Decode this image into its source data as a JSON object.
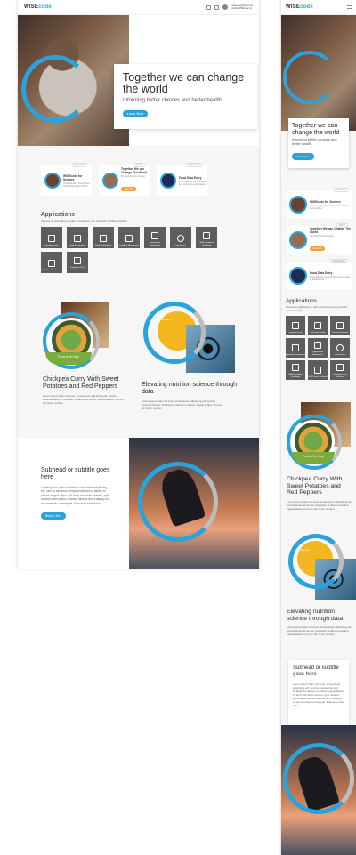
{
  "brand": {
    "logo_main": "WISE",
    "logo_accent": "code"
  },
  "header": {
    "user_name": "wisecode@wise.co.uk",
    "user_org": "Global WISEcode Inc."
  },
  "hero": {
    "title": "Together we can change the world",
    "subtitle": "Informing better choices and better health",
    "button": "Learn More"
  },
  "features": [
    {
      "tag": "Research",
      "title": "WISEcode for Science",
      "desc": "Understanding the science behind food and nutrition"
    },
    {
      "tag": "Article",
      "title": "Together We can Change The World",
      "desc": "By Food Science Insider",
      "button": "Read This"
    },
    {
      "tag": "Applications",
      "title": "Food Data Entry",
      "desc": "Enter data for your products and connect to applications"
    }
  ],
  "applications": {
    "title": "Applications",
    "subtitle": "Choose an app below to start connecting your products' nutrition insights.",
    "tiles": [
      {
        "label": "Ingredient Entry",
        "icon": "grid-icon"
      },
      {
        "label": "Food Specification",
        "icon": "grid-icon"
      },
      {
        "label": "Product Information",
        "icon": "grid-icon"
      },
      {
        "label": "Ingredient Management",
        "icon": "grid-icon"
      },
      {
        "label": "Organization Management",
        "icon": "grid-icon"
      },
      {
        "label": "Data Search",
        "icon": "search-icon"
      },
      {
        "label": "WISE Ingredient Dashboard",
        "icon": "grid-icon"
      },
      {
        "label": "WISE Food Dashboard",
        "icon": "grid-icon"
      },
      {
        "label": "Competitive Price Dashboard",
        "icon": "grid-icon"
      }
    ]
  },
  "recipe": {
    "badge": "Food of the Day",
    "title": "Chickpea Curry With Sweet Potatoes and Red Peppers",
    "body": "Lorem ipsum dolor sit amet, consectetur adipiscing elit, sed do eiusmod tempor incididunt ut labore et dolore magna aliqua. Ut enim ad minim veniam."
  },
  "science": {
    "badge": "Science",
    "title": "Elevating nutrition science through data",
    "body": "Lorem ipsum dolor sit amet, consectetur adipiscing elit, sed do eiusmod tempor incididunt ut labore et dolore magna aliqua. Ut enim ad minim veniam."
  },
  "band": {
    "title": "Subhead or subtitle goes here",
    "body": "Lorem ipsum dolor sit amet, consectetur adipiscing elit, sed do eiusmod tempor incididunt ut labore et dolore magna aliqua. Ut enim ad minim veniam, quis nostrud exercitation ullamco laboris nisi ut aliquip ex ea commodo consequat. Duis aute irure dolor.",
    "button": "Button Text"
  },
  "colors": {
    "accent": "#2aa3dc",
    "recipe_green": "#7cab3d",
    "science_yellow": "#f3b61e",
    "tile_grey": "#5d5d5d"
  }
}
